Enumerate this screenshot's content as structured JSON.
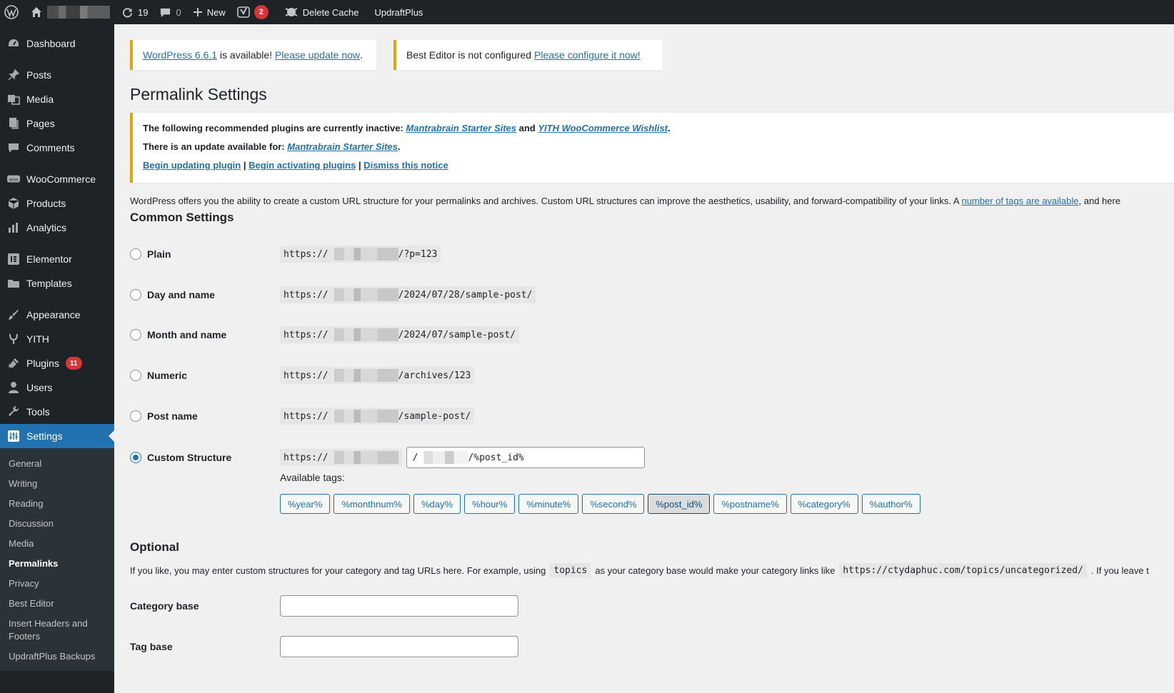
{
  "admin_bar": {
    "updates_count": "19",
    "comments_count": "0",
    "new_label": "New",
    "yoast_badge": "2",
    "delete_cache_label": "Delete Cache",
    "updraftplus_label": "UpdraftPlus"
  },
  "sidebar": {
    "items": [
      {
        "label": "Dashboard",
        "icon": "dashboard-icon"
      },
      {
        "label": "Posts",
        "icon": "pin-icon"
      },
      {
        "label": "Media",
        "icon": "media-icon"
      },
      {
        "label": "Pages",
        "icon": "pages-icon"
      },
      {
        "label": "Comments",
        "icon": "comment-icon"
      },
      {
        "label": "WooCommerce",
        "icon": "woo-icon"
      },
      {
        "label": "Products",
        "icon": "box-icon"
      },
      {
        "label": "Analytics",
        "icon": "bar-chart-icon"
      },
      {
        "label": "Elementor",
        "icon": "elementor-icon"
      },
      {
        "label": "Templates",
        "icon": "folder-icon"
      },
      {
        "label": "Appearance",
        "icon": "brush-icon"
      },
      {
        "label": "YITH",
        "icon": "yith-icon"
      },
      {
        "label": "Plugins",
        "icon": "plugin-icon",
        "badge": "11"
      },
      {
        "label": "Users",
        "icon": "user-icon"
      },
      {
        "label": "Tools",
        "icon": "wrench-icon"
      },
      {
        "label": "Settings",
        "icon": "settings-icon"
      }
    ],
    "submenu": [
      "General",
      "Writing",
      "Reading",
      "Discussion",
      "Media",
      "Permalinks",
      "Privacy",
      "Best Editor",
      "Insert Headers and Footers",
      "UpdraftPlus Backups"
    ],
    "current_sub": "Permalinks"
  },
  "notices": {
    "wp_update": {
      "link1": "WordPress 6.6.1",
      "mid": " is available! ",
      "link2": "Please update now",
      "end": "."
    },
    "best_editor": {
      "text": "Best Editor is not configured ",
      "link": "Please configure it now!"
    }
  },
  "page_title": "Permalink Settings",
  "tgm": {
    "line1_prefix": "The following recommended plugins are currently inactive: ",
    "line1_link1": "Mantrabrain Starter Sites",
    "line1_and": " and ",
    "line1_link2": "YITH WooCommerce Wishlist",
    "line1_end": ".",
    "line2_prefix": "There is an update available for: ",
    "line2_link": "Mantrabrain Starter Sites",
    "line2_end": ".",
    "link_update": "Begin updating plugin",
    "sep": " | ",
    "link_activate": "Begin activating plugins",
    "link_dismiss": "Dismiss this notice"
  },
  "intro": {
    "text": "WordPress offers you the ability to create a custom URL structure for your permalinks and archives. Custom URL structures can improve the aesthetics, usability, and forward-compatibility of your links. A ",
    "link": "number of tags are available",
    "end": ", and here"
  },
  "common_heading": "Common Settings",
  "options": [
    {
      "label": "Plain",
      "prefix": "https://",
      "suffix": "/?p=123",
      "checked": false
    },
    {
      "label": "Day and name",
      "prefix": "https://",
      "suffix": "/2024/07/28/sample-post/",
      "checked": false
    },
    {
      "label": "Month and name",
      "prefix": "https://",
      "suffix": "/2024/07/sample-post/",
      "checked": false
    },
    {
      "label": "Numeric",
      "prefix": "https://",
      "suffix": "/archives/123",
      "checked": false
    },
    {
      "label": "Post name",
      "prefix": "https://",
      "suffix": "/sample-post/",
      "checked": false
    },
    {
      "label": "Custom Structure",
      "prefix": "https://",
      "input_prefix": "/",
      "input_suffix": "/%post_id%",
      "checked": true
    }
  ],
  "available_tags_label": "Available tags:",
  "tags": [
    "%year%",
    "%monthnum%",
    "%day%",
    "%hour%",
    "%minute%",
    "%second%",
    "%post_id%",
    "%postname%",
    "%category%",
    "%author%"
  ],
  "active_tag": "%post_id%",
  "optional_heading": "Optional",
  "optional_intro": {
    "part1": "If you like, you may enter custom structures for your category and tag URLs here. For example, using",
    "code1": "topics",
    "part2": "as your category base would make your category links like",
    "code2": "https://ctydaphuc.com/topics/uncategorized/",
    "part3": ". If you leave t"
  },
  "fields": {
    "category_base_label": "Category base",
    "category_base_value": "",
    "tag_base_label": "Tag base",
    "tag_base_value": ""
  },
  "colors": {
    "accent": "#2271b1",
    "adminbar": "#1d2327",
    "notice_border": "#dba617",
    "badge": "#d63638"
  }
}
